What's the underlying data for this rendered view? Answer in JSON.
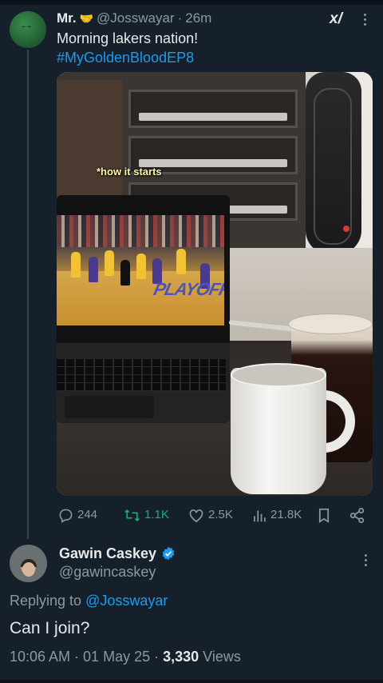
{
  "tweet": {
    "author_name": "Mr.",
    "author_emoji": "🤝",
    "handle": "@Josswayar",
    "separator": "·",
    "time": "26m",
    "text": "Morning lakers nation!",
    "hashtag": "#MyGoldenBloodEP8",
    "media_caption": "*how it starts",
    "media_word": "PLAYOFF",
    "actions": {
      "replies": "244",
      "retweets": "1.1K",
      "likes": "2.5K",
      "views": "21.8K"
    }
  },
  "reply": {
    "author_name": "Gawin Caskey",
    "handle": "@gawincaskey",
    "replying_prefix": "Replying to",
    "replying_to": "@Josswayar",
    "text": "Can I join?",
    "timestamp": "10:06 AM · 01 May 25 · ",
    "views_count": "3,330",
    "views_label": " Views"
  },
  "icons": {
    "grok": "grok-icon",
    "more": "more-icon",
    "reply": "reply-icon",
    "retweet": "retweet-icon",
    "like": "heart-icon",
    "views": "views-icon",
    "bookmark": "bookmark-icon",
    "share": "share-icon",
    "verified": "verified-icon"
  },
  "colors": {
    "background": "#15202b",
    "accent": "#1d9bf0",
    "retweet_active": "#00ba7c",
    "secondary_text": "#8b98a5"
  }
}
